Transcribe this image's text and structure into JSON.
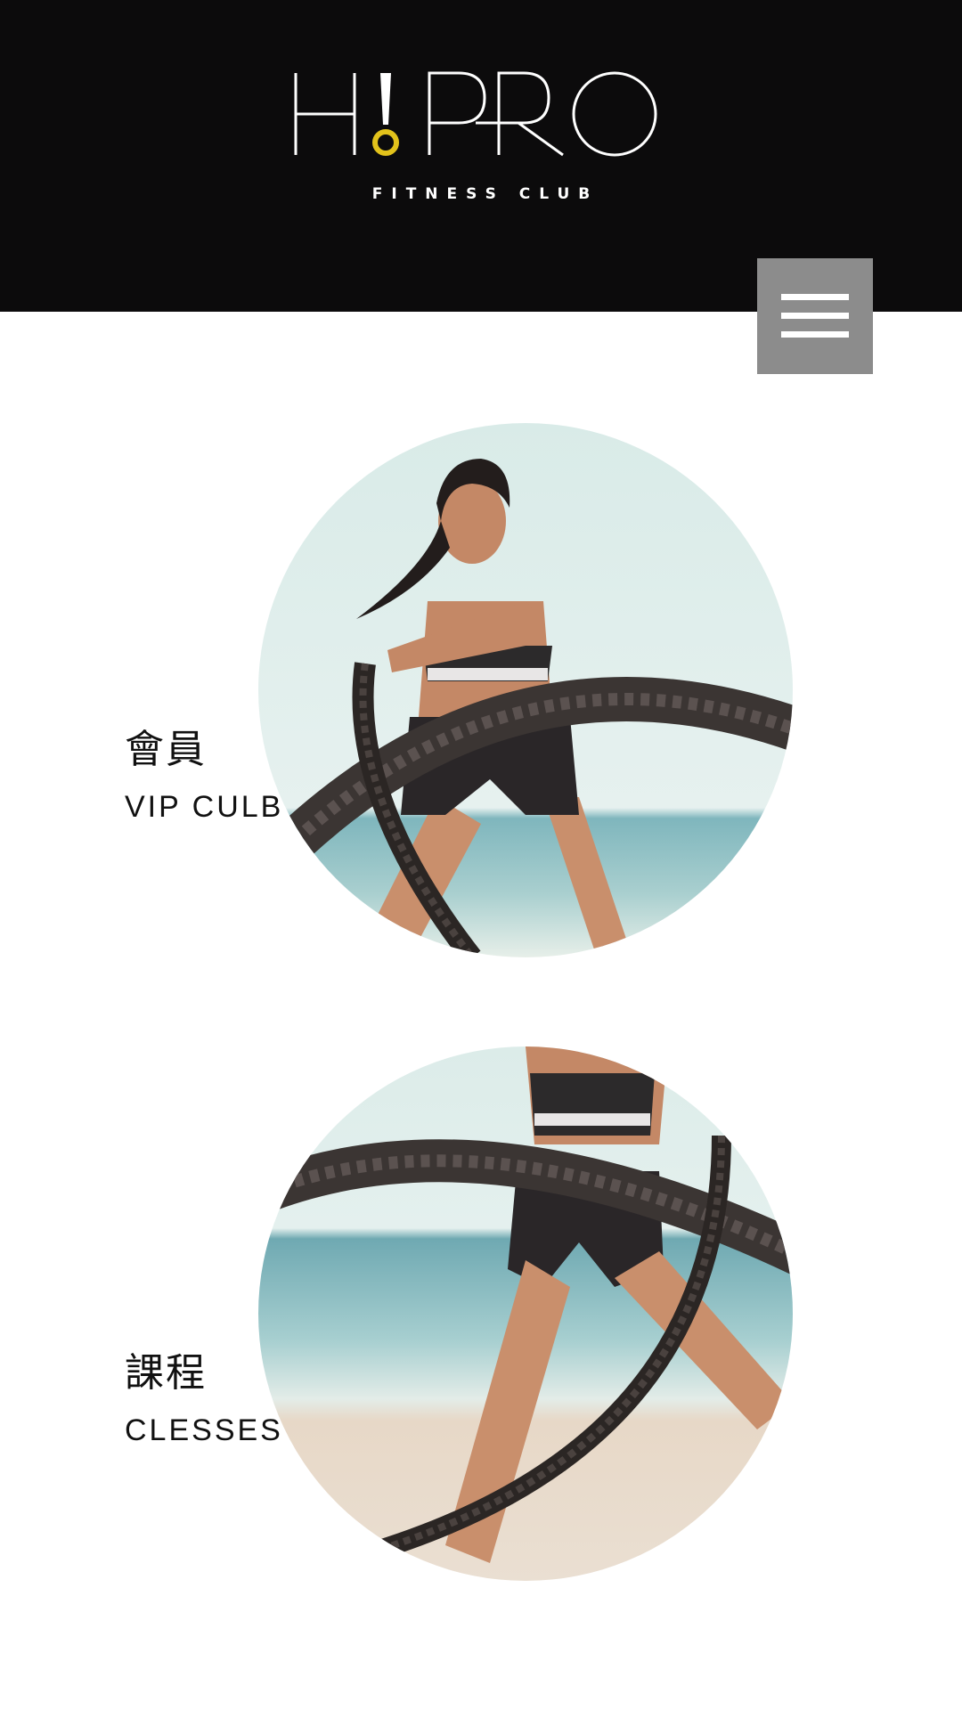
{
  "header": {
    "logo_text": "H!PRO",
    "logo_subtitle": "FITNESS CLUB",
    "background_color": "#0c0b0c",
    "accent_color": "#e2c21b"
  },
  "menu": {
    "icon": "hamburger-menu-icon",
    "button_color": "#8c8c8c"
  },
  "sections": [
    {
      "title_zh": "會員",
      "title_en": "VIP CULB",
      "image": "woman-battle-ropes-beach-photo"
    },
    {
      "title_zh": "課程",
      "title_en": "CLESSES",
      "image": "battle-ropes-beach-closeup-photo"
    }
  ]
}
